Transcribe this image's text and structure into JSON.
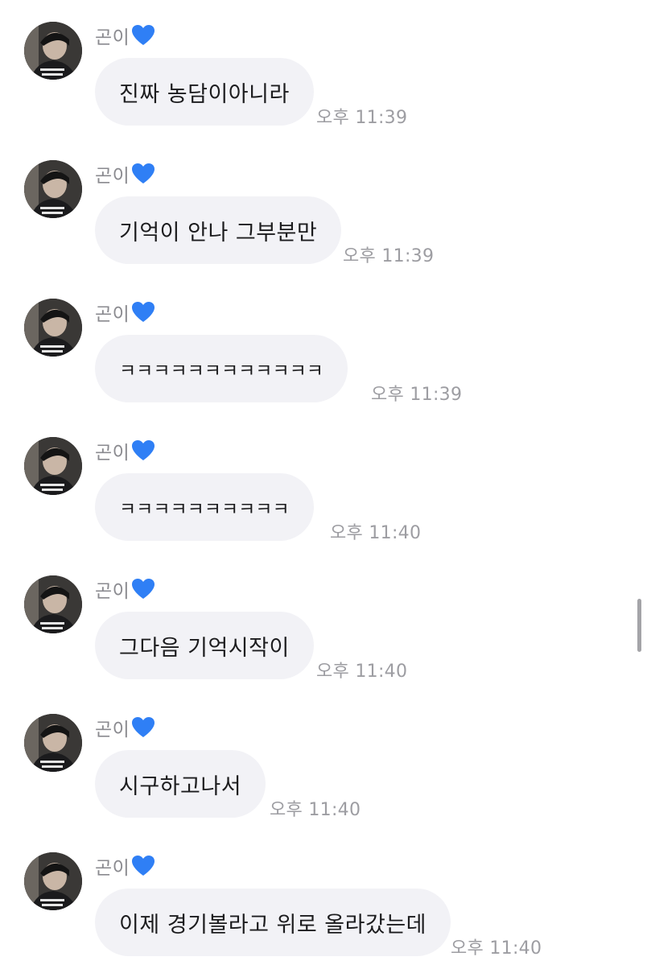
{
  "colors": {
    "bubble": "#f2f2f6",
    "heart": "#2f7ff5",
    "meta_text": "#9d9da2"
  },
  "messages": [
    {
      "sender": "곤이",
      "sender_emoji": "blue-heart-icon",
      "text": "진짜 농담이아니라",
      "time": "오후 11:39"
    },
    {
      "sender": "곤이",
      "sender_emoji": "blue-heart-icon",
      "text": "기억이 안나 그부분만",
      "time": "오후 11:39"
    },
    {
      "sender": "곤이",
      "sender_emoji": "blue-heart-icon",
      "text": "ㅋㅋㅋㅋㅋㅋㅋㅋㅋㅋㅋㅋ",
      "time": "오후 11:39"
    },
    {
      "sender": "곤이",
      "sender_emoji": "blue-heart-icon",
      "text": "ㅋㅋㅋㅋㅋㅋㅋㅋㅋㅋ",
      "time": "오후 11:40"
    },
    {
      "sender": "곤이",
      "sender_emoji": "blue-heart-icon",
      "text": "그다음 기억시작이",
      "time": "오후 11:40"
    },
    {
      "sender": "곤이",
      "sender_emoji": "blue-heart-icon",
      "text": "시구하고나서",
      "time": "오후 11:40"
    },
    {
      "sender": "곤이",
      "sender_emoji": "blue-heart-icon",
      "text": "이제 경기볼라고 위로 올라갔는데",
      "time": "오후 11:40"
    }
  ]
}
